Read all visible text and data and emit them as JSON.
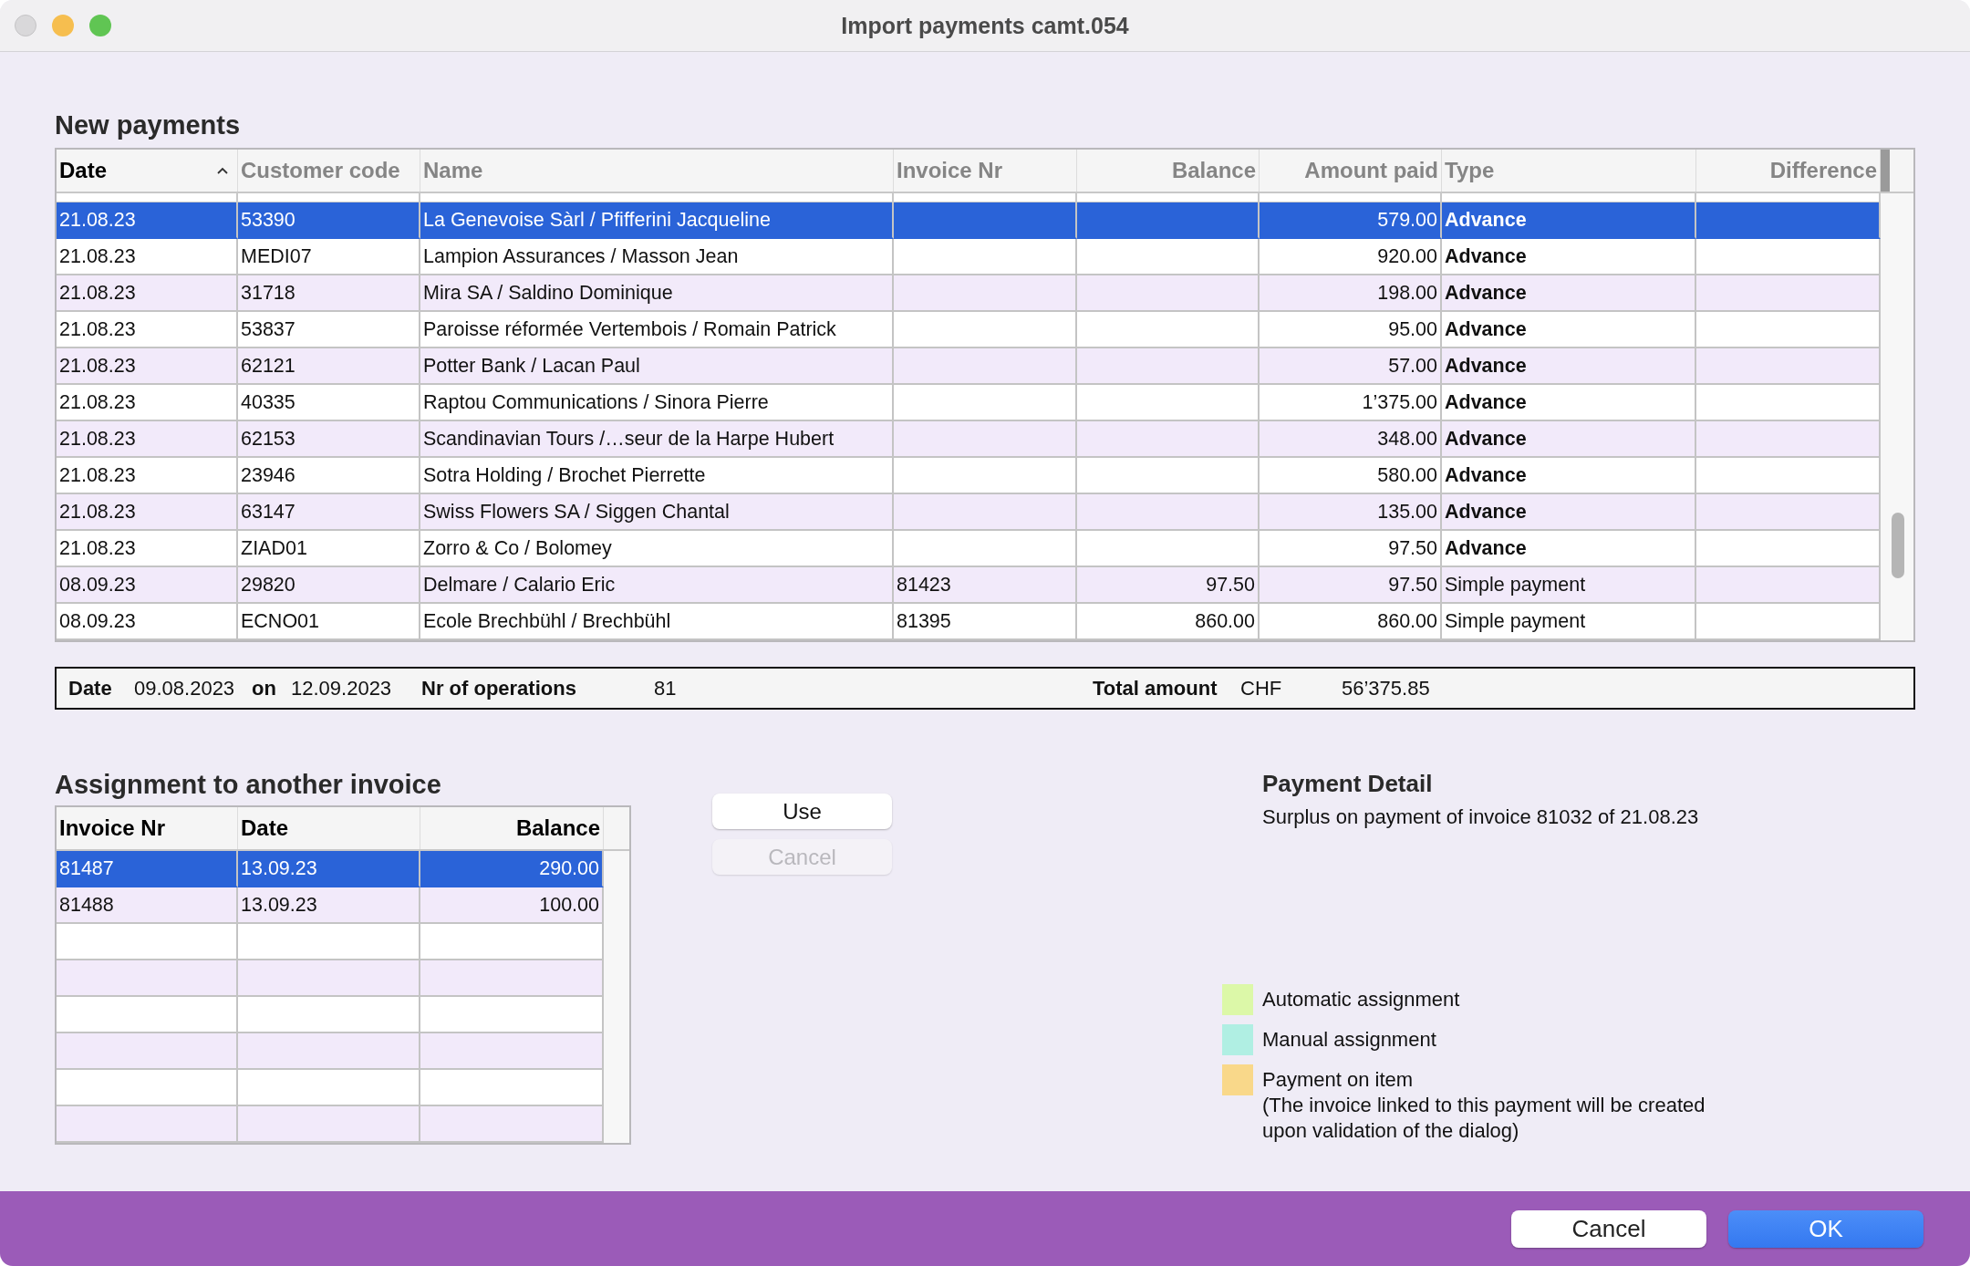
{
  "window": {
    "title": "Import payments camt.054"
  },
  "new_payments": {
    "title": "New payments",
    "columns": [
      {
        "label": "Date",
        "sorted": true
      },
      {
        "label": "Customer code",
        "sorted": false
      },
      {
        "label": "Name",
        "sorted": false
      },
      {
        "label": "Invoice Nr",
        "sorted": false
      },
      {
        "label": "Balance",
        "sorted": false
      },
      {
        "label": "Amount paid",
        "sorted": false
      },
      {
        "label": "Type",
        "sorted": false
      },
      {
        "label": "Difference",
        "sorted": false
      }
    ],
    "rows": [
      {
        "selected": true,
        "kind": "advance",
        "cells": [
          "21.08.23",
          "53390",
          "La Genevoise Sàrl / Pfifferini Jacqueline",
          "",
          "",
          "579.00",
          "Advance",
          ""
        ]
      },
      {
        "selected": false,
        "kind": "advance",
        "cells": [
          "21.08.23",
          "MEDI07",
          "Lampion Assurances / Masson Jean",
          "",
          "",
          "920.00",
          "Advance",
          ""
        ]
      },
      {
        "selected": false,
        "kind": "advance",
        "cells": [
          "21.08.23",
          "31718",
          "Mira SA / Saldino Dominique",
          "",
          "",
          "198.00",
          "Advance",
          ""
        ]
      },
      {
        "selected": false,
        "kind": "advance",
        "cells": [
          "21.08.23",
          "53837",
          "Paroisse réformée Vertembois / Romain Patrick",
          "",
          "",
          "95.00",
          "Advance",
          ""
        ]
      },
      {
        "selected": false,
        "kind": "advance",
        "cells": [
          "21.08.23",
          "62121",
          "Potter Bank / Lacan Paul",
          "",
          "",
          "57.00",
          "Advance",
          ""
        ]
      },
      {
        "selected": false,
        "kind": "advance",
        "cells": [
          "21.08.23",
          "40335",
          "Raptou Communications / Sinora Pierre",
          "",
          "",
          "1’375.00",
          "Advance",
          ""
        ]
      },
      {
        "selected": false,
        "kind": "advance",
        "cells": [
          "21.08.23",
          "62153",
          "Scandinavian Tours /…seur de la Harpe Hubert",
          "",
          "",
          "348.00",
          "Advance",
          ""
        ]
      },
      {
        "selected": false,
        "kind": "advance",
        "cells": [
          "21.08.23",
          "23946",
          "Sotra Holding / Brochet Pierrette",
          "",
          "",
          "580.00",
          "Advance",
          ""
        ]
      },
      {
        "selected": false,
        "kind": "advance",
        "cells": [
          "21.08.23",
          "63147",
          "Swiss Flowers SA / Siggen Chantal",
          "",
          "",
          "135.00",
          "Advance",
          ""
        ]
      },
      {
        "selected": false,
        "kind": "advance",
        "cells": [
          "21.08.23",
          "ZIAD01",
          "Zorro & Co / Bolomey",
          "",
          "",
          "97.50",
          "Advance",
          ""
        ]
      },
      {
        "selected": false,
        "kind": "simple",
        "cells": [
          "08.09.23",
          "29820",
          "Delmare / Calario Eric",
          "81423",
          "97.50",
          "97.50",
          "Simple payment",
          ""
        ]
      },
      {
        "selected": false,
        "kind": "simple",
        "cells": [
          "08.09.23",
          "ECNO01",
          "Ecole Brechbühl / Brechbühl",
          "81395",
          "860.00",
          "860.00",
          "Simple payment",
          ""
        ]
      }
    ]
  },
  "summary": {
    "date_label": "Date",
    "date_from": "09.08.2023",
    "on_label": "on",
    "date_to": "12.09.2023",
    "operations_label": "Nr of operations",
    "operations": "81",
    "total_label": "Total amount",
    "currency": "CHF",
    "total": "56’375.85"
  },
  "assignment": {
    "title": "Assignment to another invoice",
    "columns": [
      {
        "label": "Invoice Nr"
      },
      {
        "label": "Date"
      },
      {
        "label": "Balance"
      }
    ],
    "rows": [
      {
        "selected": true,
        "cells": [
          "81487",
          "13.09.23",
          "290.00"
        ]
      },
      {
        "selected": false,
        "cells": [
          "81488",
          "13.09.23",
          "100.00"
        ]
      }
    ],
    "buttons": [
      {
        "label": "Use",
        "disabled": false
      },
      {
        "label": "Cancel",
        "disabled": true
      }
    ]
  },
  "payment_detail": {
    "title": "Payment Detail",
    "text": "Surplus on payment of invoice 81032 of 21.08.23"
  },
  "legend": [
    {
      "color": "#dcf8a8",
      "lines": [
        "Automatic assignment"
      ]
    },
    {
      "color": "#b0efe3",
      "lines": [
        "Manual assignment"
      ]
    },
    {
      "color": "#f9d88a",
      "lines": [
        "Payment on item",
        "(The invoice linked to this payment will be created",
        "upon validation of the dialog)"
      ]
    }
  ],
  "footer_buttons": [
    {
      "label": "Cancel",
      "default": false
    },
    {
      "label": "OK",
      "default": true
    }
  ]
}
